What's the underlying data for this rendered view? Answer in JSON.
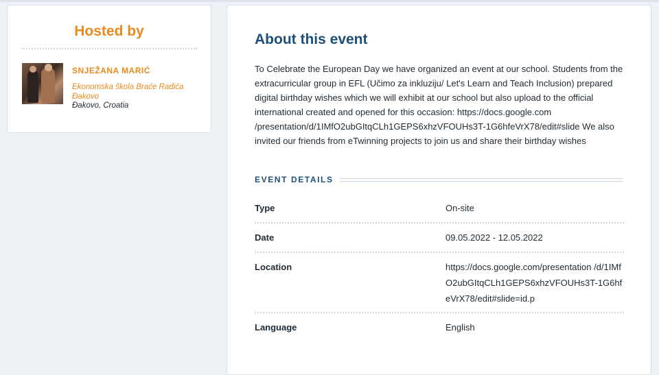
{
  "host": {
    "heading": "Hosted by",
    "name": "SNJEŽANA MARIĆ",
    "school": "Ekonomska škola Braće Radića Đakovo",
    "location": "Đakovo, Croatia"
  },
  "event": {
    "title": "About this event",
    "description": "To Celebrate the European Day we have organized an event at our school. Students from the extracurricular group in EFL (Učimo za inkluziju/ Let's Learn and Teach Inclusion) prepared digital birthday wishes which we will exhibit at our school but also upload to the official international created and opened for this occasion: https://docs.google.com /presentation/d/1IMfO2ubGItqCLh1GEPS6xhzVFOUHs3T-1G6hfeVrX78/edit#slide We also invited our friends from eTwinning projects to join us and share their birthday wishes",
    "details_heading": "EVENT DETAILS",
    "details": {
      "type": {
        "label": "Type",
        "value": "On-site"
      },
      "date": {
        "label": "Date",
        "value": "09.05.2022 - 12.05.2022"
      },
      "location": {
        "label": "Location",
        "value": "https://docs.google.com/presentation /d/1IMfO2ubGItqCLh1GEPS6xhzVFOUHs3T-1G6hfeVrX78/edit#slide=id.p"
      },
      "language": {
        "label": "Language",
        "value": "English"
      }
    }
  },
  "colors": {
    "accent_orange": "#e98a1d",
    "heading_blue": "#1d4f78"
  }
}
